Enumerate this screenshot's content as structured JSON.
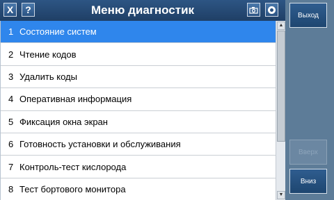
{
  "header": {
    "close_label": "X",
    "help_label": "?",
    "title": "Меню диагностик",
    "camera_icon": "camera-icon",
    "record_icon": "record-icon"
  },
  "menu": {
    "items": [
      {
        "num": "1",
        "label": "Состояние систем",
        "selected": true
      },
      {
        "num": "2",
        "label": "Чтение кодов"
      },
      {
        "num": "3",
        "label": "Удалить коды"
      },
      {
        "num": "4",
        "label": "Оперативная информация"
      },
      {
        "num": "5",
        "label": "Фиксация окна экран"
      },
      {
        "num": "6",
        "label": "Готовность установки и обслуживания"
      },
      {
        "num": "7",
        "label": "Контроль-тест кислорода"
      },
      {
        "num": "8",
        "label": "Тест бортового монитора"
      }
    ]
  },
  "side": {
    "exit_label": "Выход",
    "up_label": "Вверх",
    "down_label": "Вниз"
  },
  "colors": {
    "selected_row": "#2f86ec",
    "title_bar": "#2d5584",
    "side_panel": "#5d7c98"
  }
}
